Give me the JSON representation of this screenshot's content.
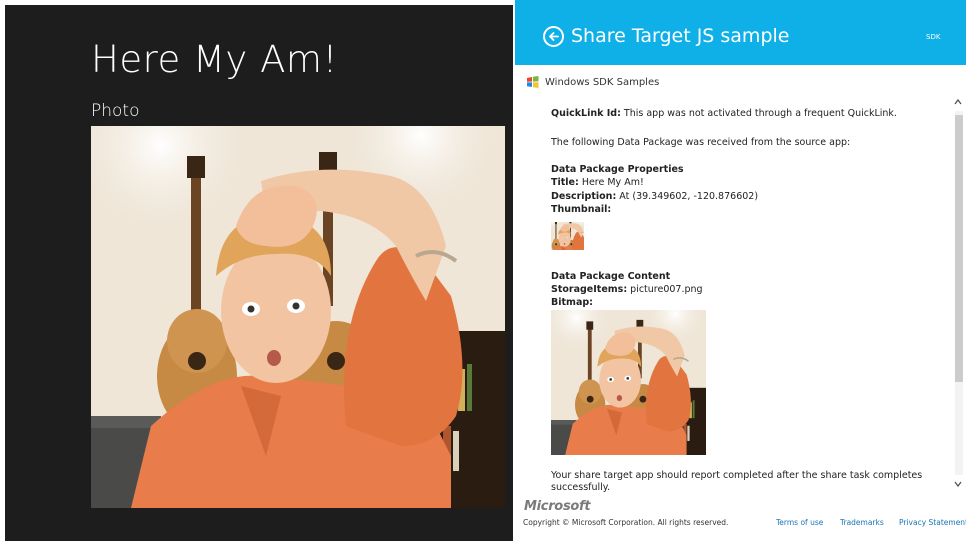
{
  "left_app": {
    "title": "Here My Am!",
    "photo_label": "Photo",
    "photo_icon": "photo-person-image"
  },
  "share_pane": {
    "header": {
      "title": "Share Target JS sample",
      "sdk_label": "SDK",
      "back_icon": "back-arrow-circle-icon",
      "color": "#0fb0e8"
    },
    "brand": "Windows SDK Samples",
    "content": {
      "quicklink_label": "QuickLink Id:",
      "quicklink_value": "This app was not activated through a frequent QuickLink.",
      "received_text": "The following Data Package was received from the source app:",
      "props_heading": "Data Package Properties",
      "title_label": "Title:",
      "title_value": "Here My Am!",
      "description_label": "Description:",
      "description_value": "At (39.349602, -120.876602)",
      "thumbnail_label": "Thumbnail:",
      "content_heading": "Data Package Content",
      "storage_label": "StorageItems:",
      "storage_value": "picture007.png",
      "bitmap_label": "Bitmap:",
      "report_text": "Your share target app should report completed after the share task completes successfully."
    },
    "ms_logo": "Microsoft",
    "footer": {
      "copyright": "Copyright © Microsoft Corporation. All rights reserved.",
      "terms": "Terms of use",
      "trademarks": "Trademarks",
      "privacy": "Privacy Statement"
    }
  }
}
